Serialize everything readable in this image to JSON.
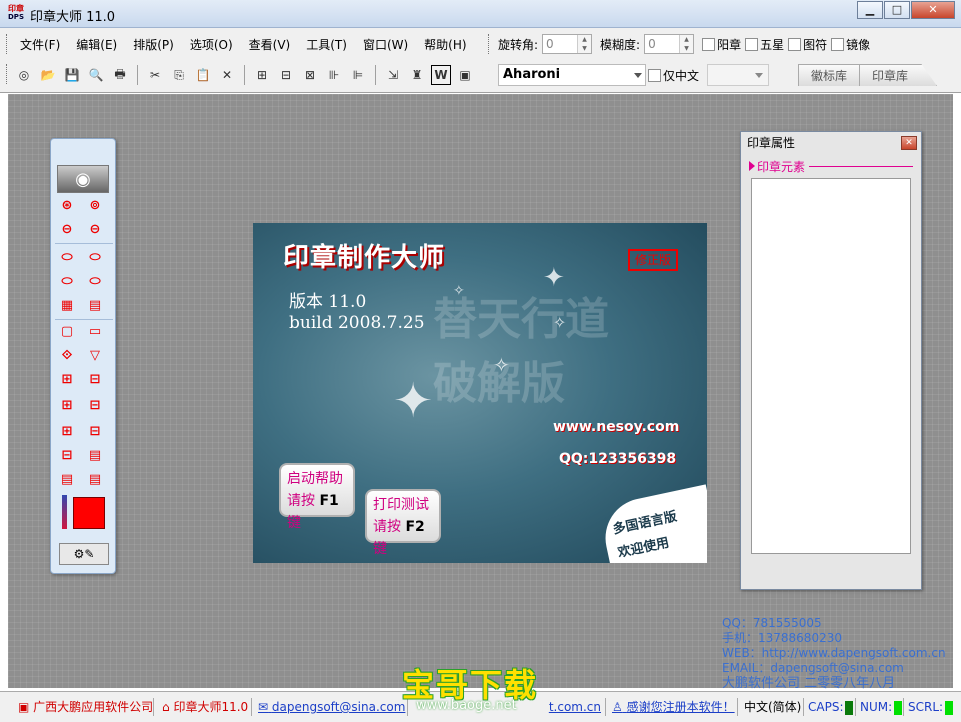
{
  "window": {
    "title": "印章大师 11.0",
    "app_icon_top": "印章",
    "app_icon_bottom": "DPS",
    "minimize_glyph": "▁",
    "maximize_glyph": "□",
    "close_glyph": "✕"
  },
  "menu": [
    {
      "label": "文件(F)"
    },
    {
      "label": "编辑(E)"
    },
    {
      "label": "排版(P)"
    },
    {
      "label": "选项(O)"
    },
    {
      "label": "查看(V)"
    },
    {
      "label": "工具(T)"
    },
    {
      "label": "窗口(W)"
    },
    {
      "label": "帮助(H)"
    }
  ],
  "toolbar": {
    "icons": [
      "new-icon",
      "open-icon",
      "save-icon",
      "preview-icon",
      "print-icon",
      "cut-icon",
      "copy-icon",
      "paste-icon",
      "delete-icon",
      "align-center-icon",
      "align-left-icon",
      "align-right-icon",
      "distribute-horizontal-icon",
      "distribute-vertical-icon",
      "export-icon",
      "stamp-icon",
      "word-icon",
      "image-icon"
    ],
    "glyphs": [
      "◎",
      "📂",
      "💾",
      "🔍",
      "🖶",
      "✂",
      "⎘",
      "📋",
      "✕",
      "⊞",
      "⊟",
      "⊠",
      "⊪",
      "⊫",
      "⇲",
      "♜",
      "W",
      "▣"
    ]
  },
  "controls": {
    "rotation_label": "旋转角:",
    "rotation_value": "0",
    "blur_label": "模糊度:",
    "blur_value": "0",
    "checkboxes": [
      "阳章",
      "五星",
      "图符",
      "镜像"
    ],
    "font_name": "Aharoni",
    "chinese_only_label": "仅中文",
    "font_size_value": ""
  },
  "tabs": [
    "徽标库",
    "印章库"
  ],
  "palette": {
    "row_glyphs": [
      "⊛",
      "⊚",
      "⊖",
      "⊖",
      "⬭",
      "⬭",
      "⬭",
      "⬭",
      "▦",
      "▤",
      "▢",
      "▭",
      "⟐",
      "▽",
      "⊞",
      "⊟",
      "⊞",
      "⊟",
      "⊞",
      "⊟",
      "⊟",
      "▤",
      "▤",
      "▤"
    ],
    "eye_glyph": "◉",
    "bottom_glyph": "⚙✎",
    "current_color": "#ff0000"
  },
  "splash": {
    "title": "印章制作大师",
    "version": "版本 11.0",
    "build": "build 2008.7.25",
    "stamp_label": "修正版",
    "calligraphy": "替天行道 破解版",
    "url": "www.nesoy.com",
    "qq": "QQ:123356398",
    "btn_help_line1": "启动帮助",
    "btn_help_line2": "请按",
    "btn_help_key": "F1",
    "btn_help_line3": "键",
    "btn_print_line1": "打印测试",
    "btn_print_line2": "请按",
    "btn_print_key": "F2",
    "btn_print_line3": "键",
    "badge_line1": "多国语言版",
    "badge_line2": "欢迎使用"
  },
  "properties_panel": {
    "title": "印章属性",
    "section": "印章元素",
    "close_glyph": "✕"
  },
  "contact": {
    "qq": "QQ：781555005",
    "phone": "手机：13788680230",
    "web": "WEB：http://www.dapengsoft.com.cn",
    "email": "EMAIL：dapengsoft@sina.com",
    "company": "大鹏软件公司 二零零八年八月"
  },
  "watermark": {
    "big": "宝哥下载",
    "small": "www.baoge.net"
  },
  "statusbar": {
    "company": "广西大鹏应用软件公司",
    "app": "印章大师11.0",
    "email": "dapengsoft@sina.com",
    "web": "t.com.cn",
    "thanks": "感谢您注册本软件！",
    "ime": "中文(简体)",
    "caps": "CAPS:",
    "num": "NUM:",
    "scrl": "SCRL:"
  },
  "colors": {
    "accent_red": "#ff0000",
    "magenta": "#e00090",
    "link_blue": "#3a6fd0"
  }
}
